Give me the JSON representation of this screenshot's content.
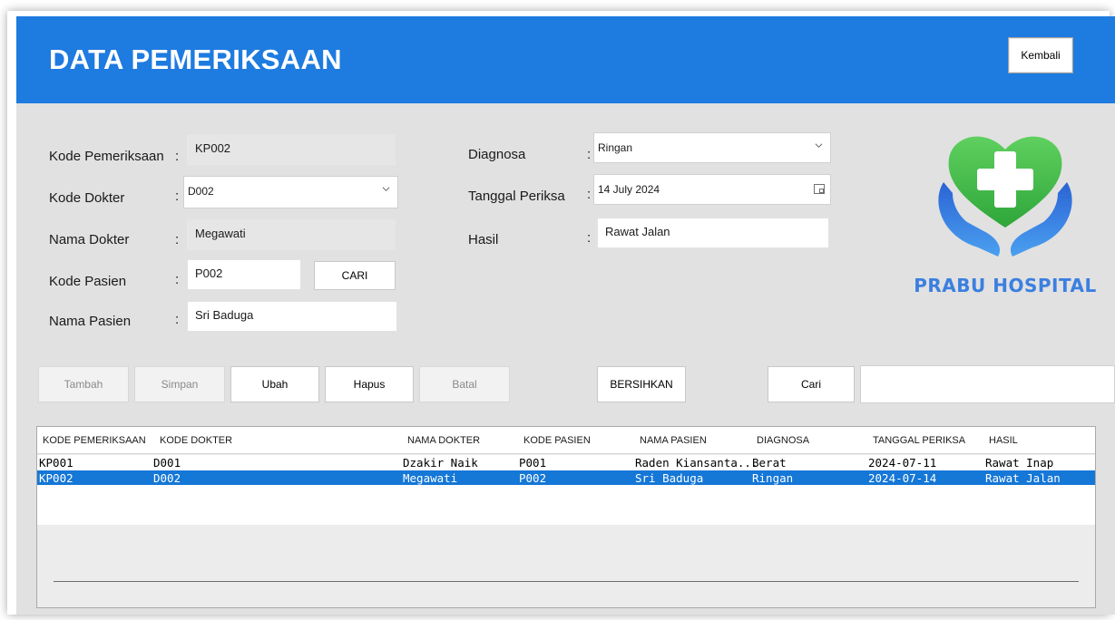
{
  "header": {
    "title": "DATA PEMERIKSAAN",
    "back_label": "Kembali"
  },
  "form": {
    "kode_pemeriksaan": {
      "label": "Kode Pemeriksaan",
      "value": "KP002"
    },
    "kode_dokter": {
      "label": "Kode Dokter",
      "value": "D002"
    },
    "nama_dokter": {
      "label": "Nama Dokter",
      "value": "Megawati"
    },
    "kode_pasien": {
      "label": "Kode Pasien",
      "value": "P002",
      "cari_label": "CARI"
    },
    "nama_pasien": {
      "label": "Nama Pasien",
      "value": "Sri Baduga"
    },
    "diagnosa": {
      "label": "Diagnosa",
      "value": "Ringan"
    },
    "tanggal": {
      "label": "Tanggal Periksa",
      "value": "14 July  2024"
    },
    "hasil": {
      "label": "Hasil",
      "value": "Rawat Jalan"
    },
    "colon": ":"
  },
  "logo": {
    "text": "PRABU HOSPITAL",
    "icon": "heart-cross-hands-icon"
  },
  "actions": {
    "tambah": "Tambah",
    "simpan": "Simpan",
    "ubah": "Ubah",
    "hapus": "Hapus",
    "batal": "Batal",
    "bersihkan": "BERSIHKAN",
    "cari": "Cari"
  },
  "table": {
    "columns": [
      "KODE PEMERIKSAAN",
      "KODE DOKTER",
      "NAMA DOKTER",
      "KODE PASIEN",
      "NAMA PASIEN",
      "DIAGNOSA",
      "TANGGAL PERIKSA",
      "HASIL"
    ],
    "rows": [
      [
        "KP001",
        "D001",
        "Dzakir Naik",
        "P001",
        "Raden Kiansanta...",
        "Berat",
        "2024-07-11",
        "Rawat Inap"
      ],
      [
        "KP002",
        "D002",
        "Megawati",
        "P002",
        "Sri Baduga",
        "Ringan",
        "2024-07-14",
        "Rawat Jalan"
      ]
    ],
    "selected_row": 1
  },
  "colors": {
    "header_blue": "#1e7be0",
    "selection_blue": "#1577d6",
    "logo_green": "#3cbf3c",
    "logo_blue": "#2f6fdc"
  }
}
